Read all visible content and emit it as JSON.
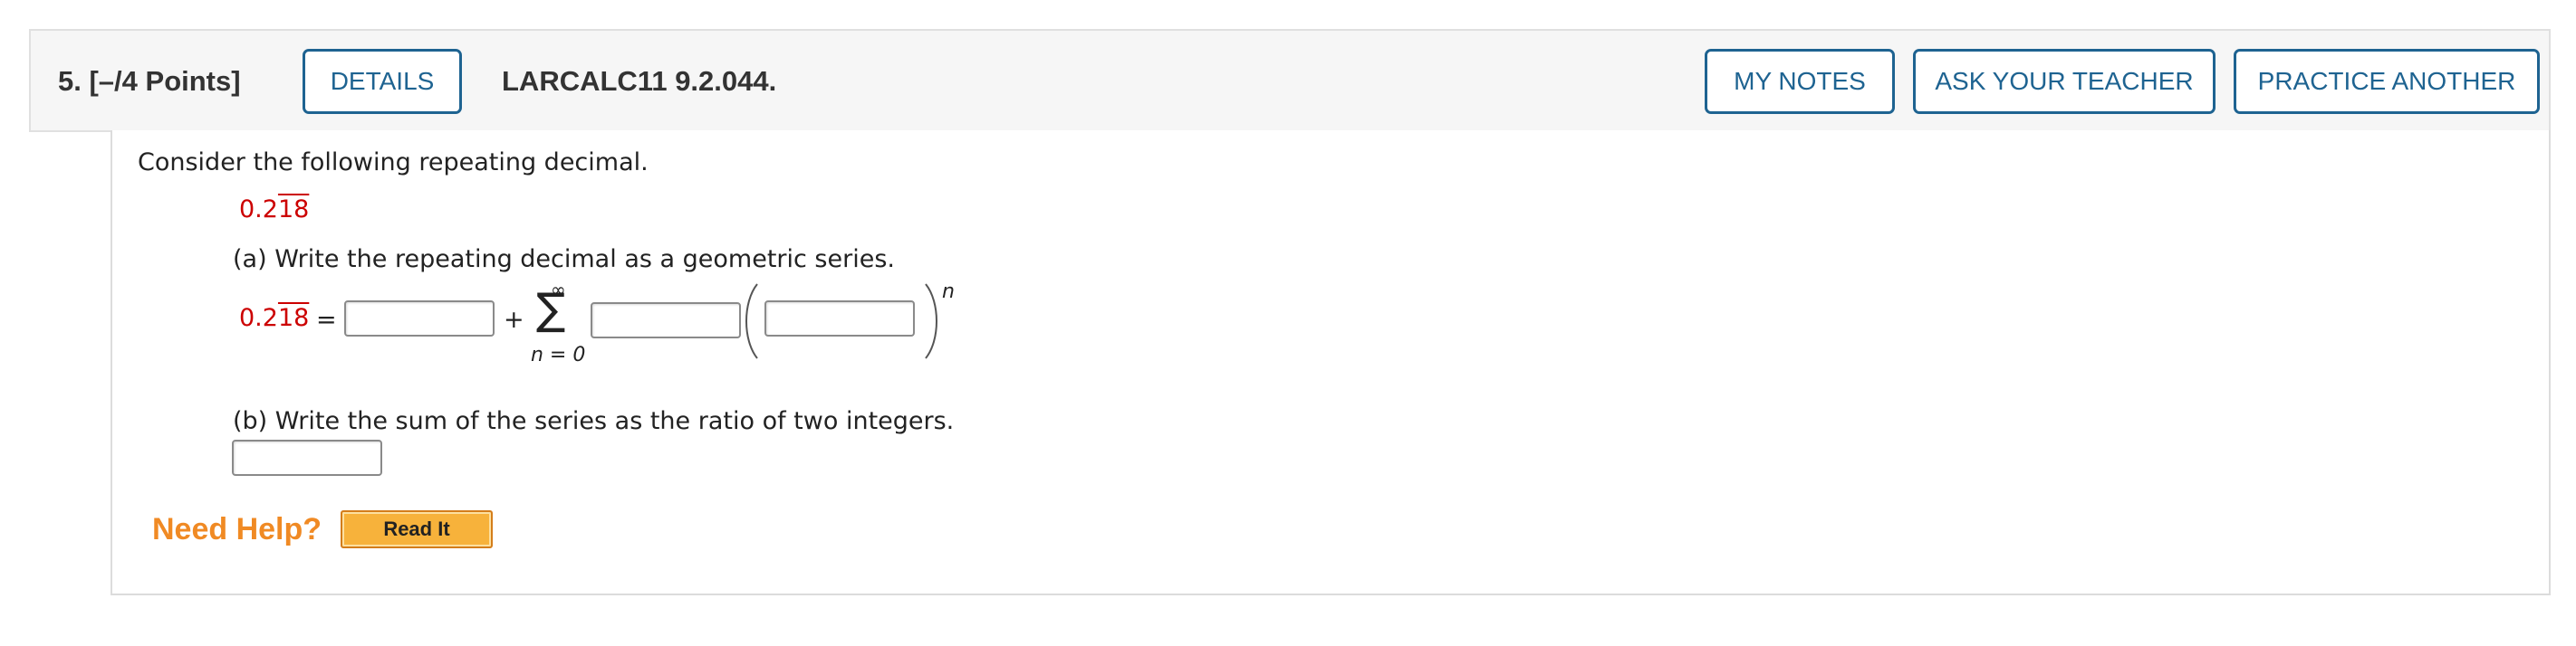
{
  "header": {
    "question_number": "5.",
    "points": "[–/4 Points]",
    "details_label": "DETAILS",
    "question_id": "LARCALC11 9.2.044.",
    "my_notes_label": "MY NOTES",
    "ask_teacher_label": "ASK YOUR TEACHER",
    "practice_another_label": "PRACTICE ANOTHER"
  },
  "question": {
    "prompt": "Consider the following repeating decimal.",
    "decimal_prefix": "0.2",
    "decimal_repeat": "18",
    "part_a": "(a) Write the repeating decimal as a geometric series.",
    "equals": "=",
    "plus": "+",
    "sum_symbol": "∑",
    "infinity": "∞",
    "sum_lower": "n = 0",
    "exponent": "n",
    "part_b": "(b) Write the sum of the series as the ratio of two integers."
  },
  "help": {
    "label": "Need Help?",
    "read_it_label": "Read It"
  },
  "colors": {
    "button_border": "#1e6391",
    "decimal_red": "#cc0000",
    "help_orange": "#f08a24",
    "read_it_bg": "#f7b23b"
  }
}
